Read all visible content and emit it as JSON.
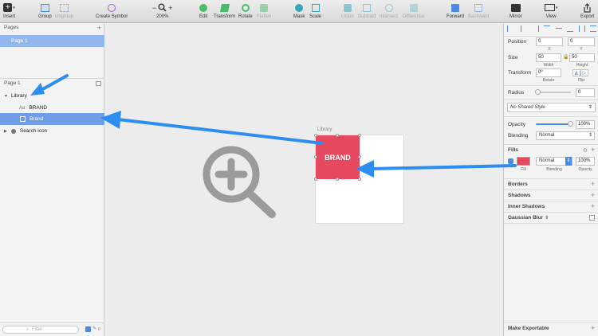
{
  "toolbar": {
    "insert": "Insert",
    "group": "Group",
    "ungroup": "Ungroup",
    "create_symbol": "Create Symbol",
    "zoom": "200%",
    "edit": "Edit",
    "transform": "Transform",
    "rotate": "Rotate",
    "flatten": "Flatten",
    "mask": "Mask",
    "scale": "Scale",
    "union": "Union",
    "subtract": "Subtract",
    "intersect": "Intersect",
    "difference": "Difference",
    "forward": "Forward",
    "backward": "Backward",
    "mirror": "Mirror",
    "view": "View",
    "export": "Export"
  },
  "left": {
    "pages_header": "Pages",
    "page_selected": "Page 1",
    "layers_header": "Page 1",
    "layers": {
      "library": "Library",
      "brand_text_prefix": "Aa",
      "brand_text": "BRAND",
      "brand_rect": "Brand",
      "search_icon": "Search icon"
    },
    "filter_placeholder": "Filter",
    "filter_count": "0"
  },
  "canvas": {
    "artboard_label": "Library",
    "brand_label": "BRAND"
  },
  "inspector": {
    "position_label": "Position",
    "x_value": "0",
    "y_value": "0",
    "x_sub": "X",
    "y_sub": "Y",
    "size_label": "Size",
    "width_value": "50",
    "height_value": "50",
    "width_sub": "Width",
    "height_sub": "Height",
    "transform_label": "Transform",
    "rotate_value": "0º",
    "rotate_sub": "Rotate",
    "flip_sub": "Flip",
    "radius_label": "Radius",
    "radius_value": "0",
    "shared_style": "No Shared Style",
    "opacity_label": "Opacity",
    "opacity_value": "100%",
    "blending_label": "Blending",
    "blending_value": "Normal",
    "fills_label": "Fills",
    "fill_blending_value": "Normal",
    "fill_opacity_value": "100%",
    "fill_sub": "Fill",
    "fill_blending_sub": "Blending",
    "fill_opacity_sub": "Opacity",
    "borders": "Borders",
    "shadows": "Shadows",
    "inner_shadows": "Inner Shadows",
    "gaussian_blur": "Gaussian Blur",
    "make_exportable": "Make Exportable",
    "fill_color": "#e5485f",
    "opacity_fraction": 1.0
  },
  "colors": {
    "brand": "#e5485f",
    "selection": "#6f9de6",
    "arrow": "#2d8ef0",
    "search_icon": "#9b9b9b"
  }
}
